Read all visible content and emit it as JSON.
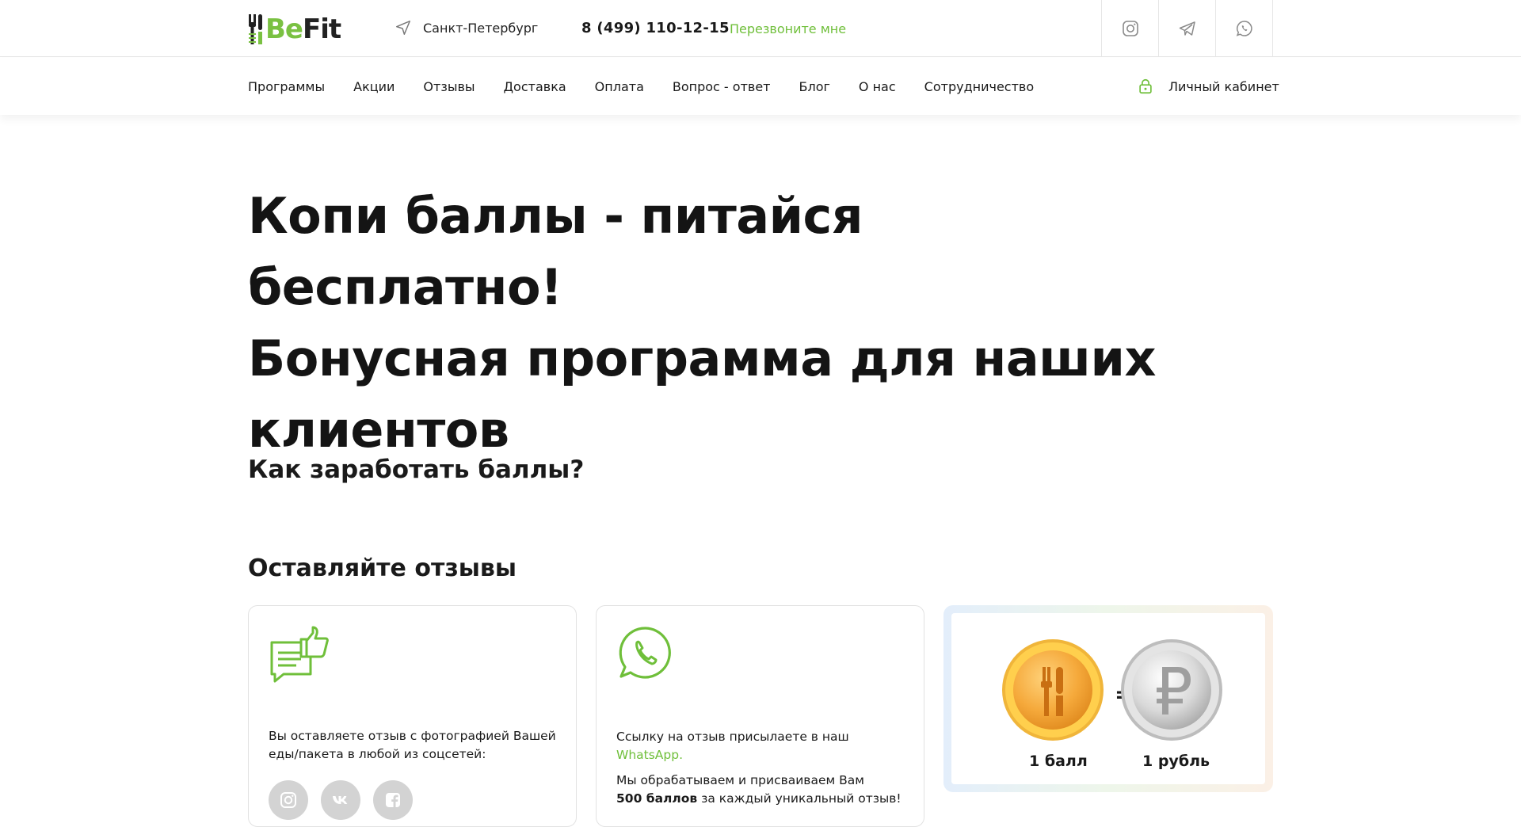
{
  "header": {
    "logo_be": "Be",
    "logo_fit": "Fit",
    "city": "Санкт-Петербург",
    "phone": "8 (499) 110-12-15",
    "callback": "Перезвоните мне",
    "social_icons": [
      "instagram-icon",
      "telegram-icon",
      "whatsapp-icon"
    ]
  },
  "nav": {
    "items": [
      {
        "label": "Программы"
      },
      {
        "label": "Акции"
      },
      {
        "label": "Отзывы"
      },
      {
        "label": "Доставка"
      },
      {
        "label": "Оплата"
      },
      {
        "label": "Вопрос - ответ"
      },
      {
        "label": "Блог"
      },
      {
        "label": "О нас"
      },
      {
        "label": "Сотрудничество"
      }
    ],
    "account": "Личный кабинет"
  },
  "hero": {
    "title_line1": "Копи баллы - питайся бесплатно!",
    "title_line2": "Бонусная программа для наших",
    "title_line3": "клиентов"
  },
  "section": {
    "how_title": "Как заработать баллы?",
    "reviews_title": "Оставляйте отзывы"
  },
  "cards": {
    "card1": {
      "text": "Вы оставляете отзыв с фотографией Вашей еды/пакета в любой из соцсетей:",
      "social_icons": [
        "instagram-icon",
        "vk-icon",
        "facebook-icon"
      ]
    },
    "card2": {
      "text_before": "Ссылку на отзыв присылаете в наш ",
      "text_link": "WhatsApp.",
      "text2_bold": "500 баллов",
      "text2_before": "Мы обрабатываем и присваиваем Вам",
      "text2_after": " за каждый уникальный отзыв!"
    },
    "card3": {
      "label_point": "1 балл",
      "equals": "=",
      "label_ruble": "1 рубль"
    }
  },
  "colors": {
    "accent": "#6fbf3a",
    "text": "#1a1a1a",
    "border": "#e6e6e6"
  }
}
